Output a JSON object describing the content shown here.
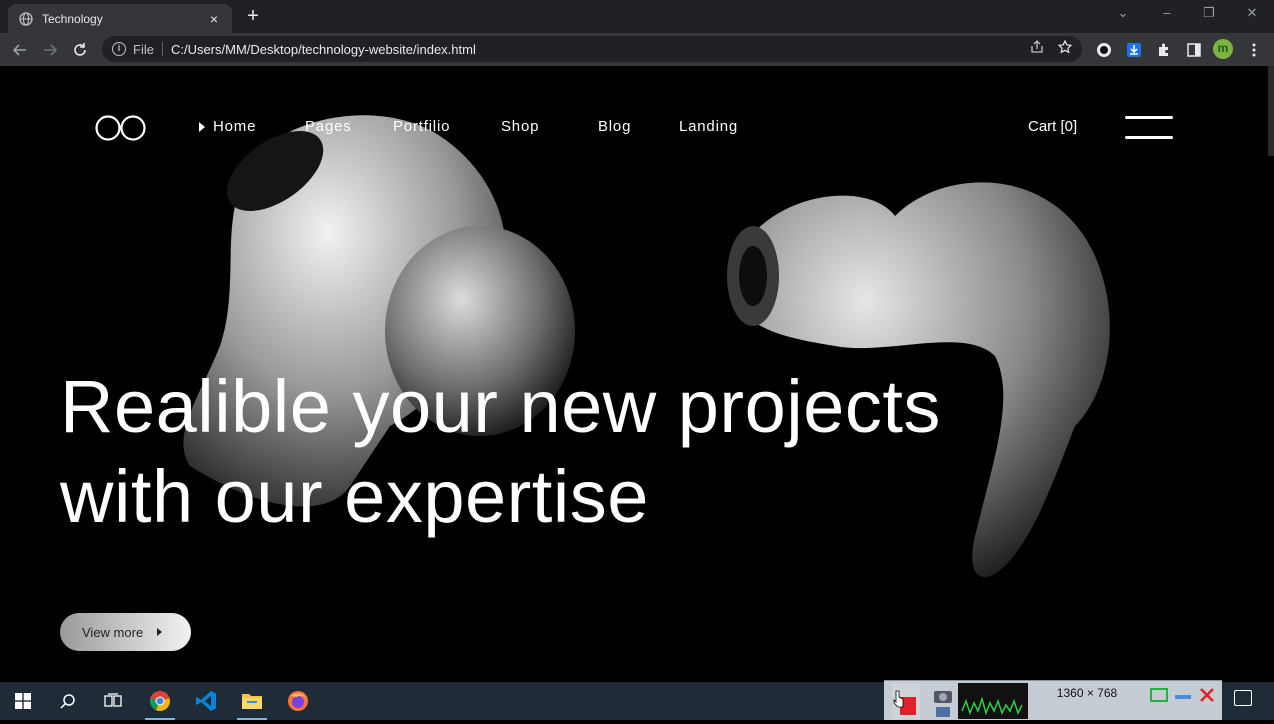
{
  "browser": {
    "tab_title": "Technology",
    "new_tab": "+",
    "close_tab": "×",
    "omnibox": {
      "scheme": "File",
      "url": "C:/Users/MM/Desktop/technology-website/index.html"
    },
    "profile_initial": "m"
  },
  "site": {
    "nav": [
      {
        "label": "Home",
        "active": true
      },
      {
        "label": "Pages"
      },
      {
        "label": "Portfilio"
      },
      {
        "label": "Shop"
      },
      {
        "label": "Blog"
      },
      {
        "label": "Landing"
      }
    ],
    "cart": "Cart [0]",
    "headline_line1": "Realible your new projects",
    "headline_line2": "with our expertise",
    "cta": "View more"
  },
  "taskbar": {
    "apps": [
      "start-icon",
      "search-icon",
      "task-view-icon",
      "chrome-icon",
      "vscode-icon",
      "file-explorer-icon",
      "firefox-icon"
    ],
    "recorder_size": "1360 × 768"
  }
}
